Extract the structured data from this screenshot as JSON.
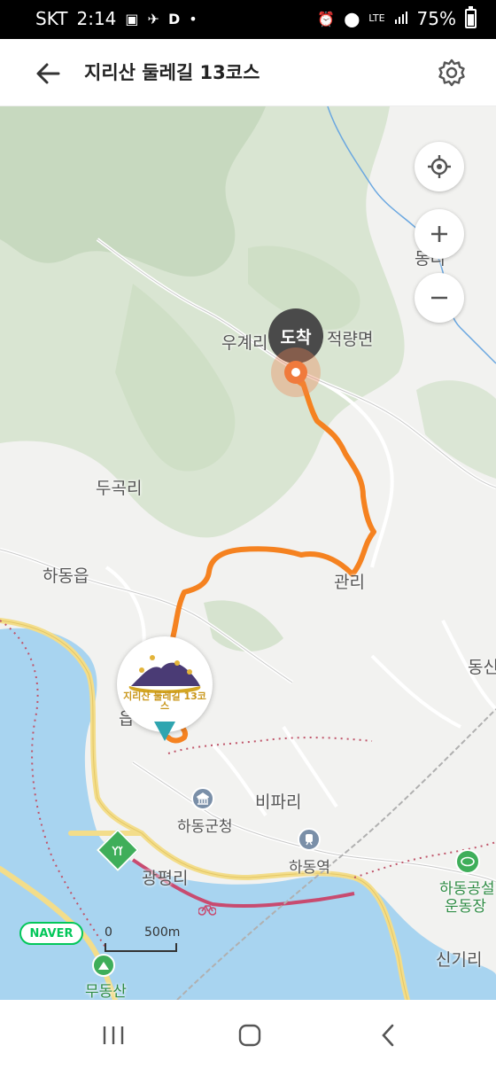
{
  "status_bar": {
    "carrier": "SKT",
    "time": "2:14",
    "network": "LTE",
    "battery": "75%",
    "icons": [
      "image-icon",
      "satellite-icon",
      "d-app-icon",
      "dot-icon",
      "alarm-icon",
      "location-icon",
      "signal-icon",
      "battery-icon"
    ]
  },
  "header": {
    "title": "지리산 둘레길 13코스",
    "back_icon": "arrow-left-icon",
    "settings_icon": "gear-icon"
  },
  "map": {
    "arrival_label": "도착",
    "course_marker_text": "지리산 둘레길 13코스",
    "labels": {
      "ugyeri": "우계리",
      "jeokryangmyeon": "적량면",
      "dongri": "동리",
      "dugokri": "두곡리",
      "hadongeup": "하동읍",
      "gwanri": "관리",
      "dong_right": "동신",
      "eup": "읍",
      "bipari": "비파리",
      "hadong_county_office": "하동군청",
      "hadong_station": "하동역",
      "gwangpyeongri": "광평리",
      "hadong_stadium_line1": "하동공설",
      "hadong_stadium_line2": "운동장",
      "singiri": "신기리",
      "mudongsan": "무동산"
    },
    "logo": "NAVER",
    "scale": {
      "start": "0",
      "end": "500m"
    },
    "colors": {
      "route": "#f58220",
      "water": "#a8d4f0",
      "forest": "#d7e3cf",
      "road": "#f3dd8a"
    }
  },
  "controls": {
    "locate_icon": "crosshair-icon",
    "zoom_in_icon": "plus-icon",
    "zoom_out_icon": "minus-icon"
  },
  "nav_bar": {
    "recents_icon": "recents-icon",
    "home_icon": "home-icon",
    "back_icon": "chevron-left-icon"
  }
}
